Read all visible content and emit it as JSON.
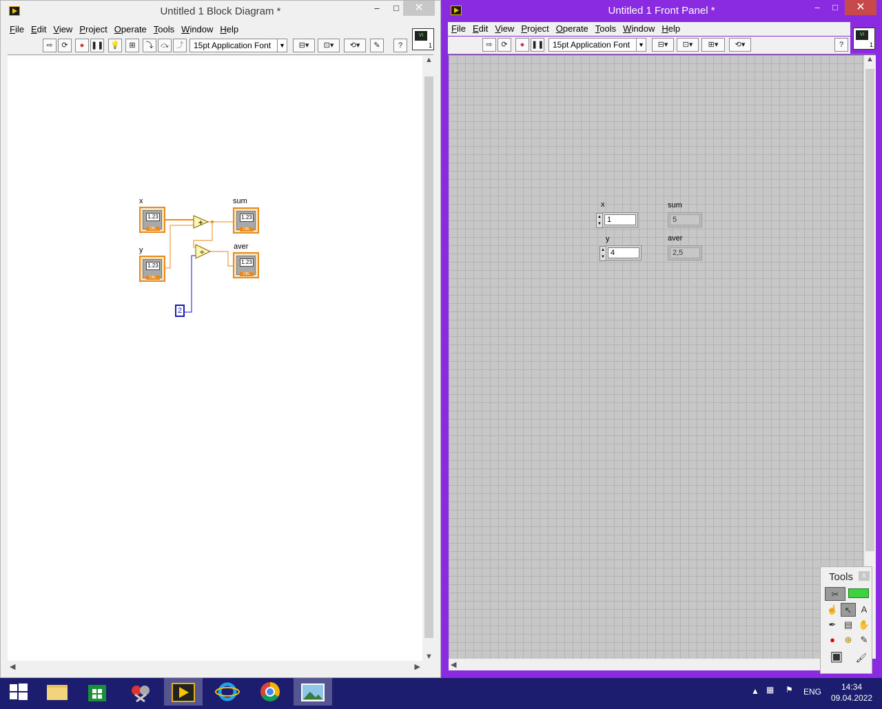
{
  "block_diagram": {
    "title": "Untitled 1 Block Diagram *",
    "menu": [
      "File",
      "Edit",
      "View",
      "Project",
      "Operate",
      "Tools",
      "Window",
      "Help"
    ],
    "font": "15pt Application Font",
    "vi_icon_number": "1",
    "nodes": {
      "x_label": "x",
      "y_label": "y",
      "sum_label": "sum",
      "aver_label": "aver",
      "numeric_text": "1.23",
      "dbl_text": "DBL",
      "const_value": "2",
      "add_op": "+",
      "div_op": "÷"
    }
  },
  "front_panel": {
    "title": "Untitled 1 Front Panel *",
    "menu": [
      "File",
      "Edit",
      "View",
      "Project",
      "Operate",
      "Tools",
      "Window",
      "Help"
    ],
    "font": "15pt Application Font",
    "vi_icon_number": "1",
    "controls": {
      "x_label": "x",
      "x_value": "1",
      "y_label": "y",
      "y_value": "4",
      "sum_label": "sum",
      "sum_value": "5",
      "aver_label": "aver",
      "aver_value": "2,5"
    }
  },
  "tools_palette": {
    "title": "Tools",
    "close": "x"
  },
  "window_buttons": {
    "minimize": "–",
    "maximize": "□",
    "close": "✕"
  },
  "taskbar": {
    "lang": "ENG",
    "time": "14:34",
    "date": "09.04.2022"
  }
}
